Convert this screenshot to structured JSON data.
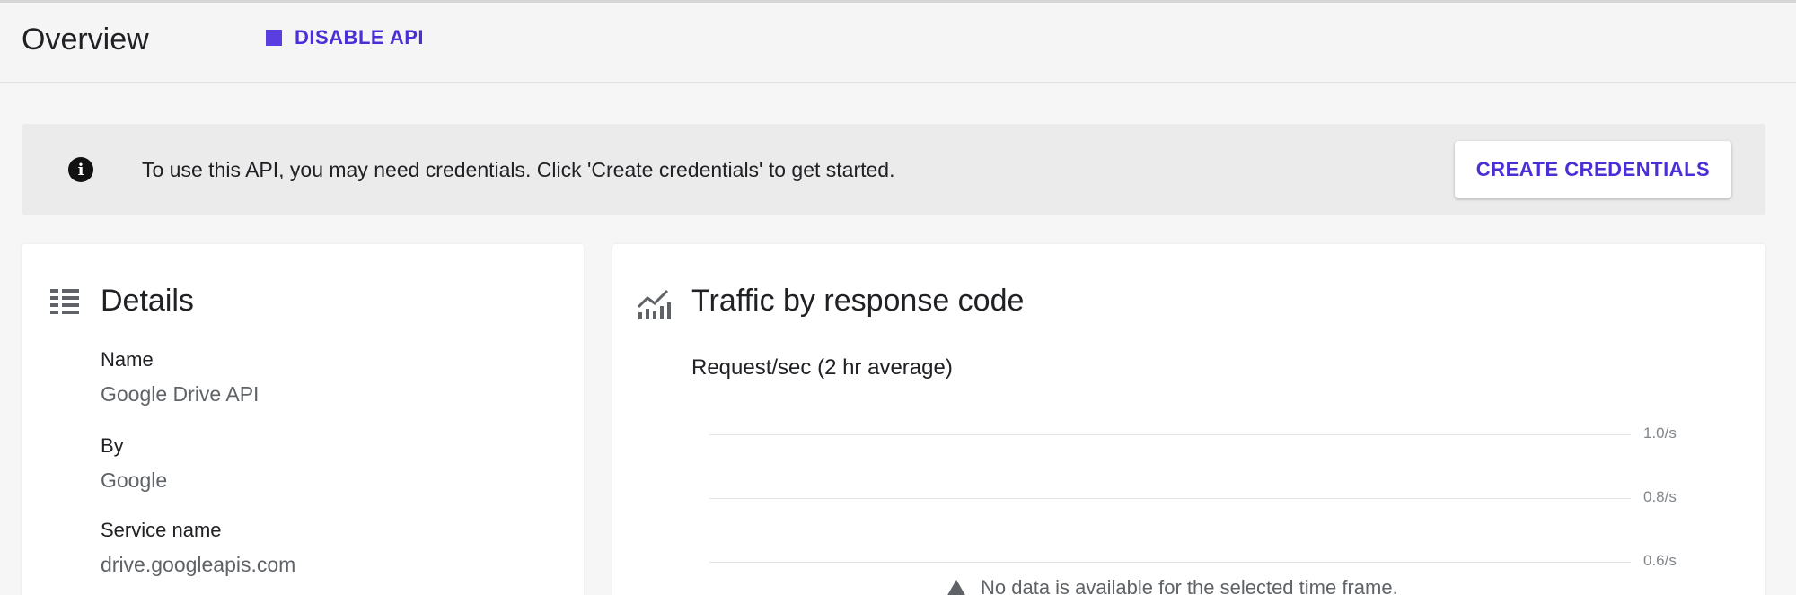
{
  "header": {
    "title": "Overview",
    "disable_label": "DISABLE API",
    "disable_icon": "stop-icon"
  },
  "banner": {
    "icon": "info-icon",
    "info_glyph": "i",
    "text": "To use this API, you may need credentials. Click 'Create credentials' to get started.",
    "action_label": "CREATE CREDENTIALS"
  },
  "details": {
    "icon": "details-list-icon",
    "title": "Details",
    "fields": [
      {
        "label": "Name",
        "value": "Google Drive API"
      },
      {
        "label": "By",
        "value": "Google"
      },
      {
        "label": "Service name",
        "value": "drive.googleapis.com"
      }
    ]
  },
  "traffic": {
    "icon": "traffic-chart-icon",
    "title": "Traffic by response code",
    "subtitle": "Request/sec (2 hr average)",
    "ticks": [
      "1.0/s",
      "0.8/s",
      "0.6/s"
    ],
    "no_data": "No data is available for the selected time frame."
  },
  "colors": {
    "accent": "#4a2fd6",
    "background": "#f6f6f6",
    "banner": "#ebebeb"
  }
}
